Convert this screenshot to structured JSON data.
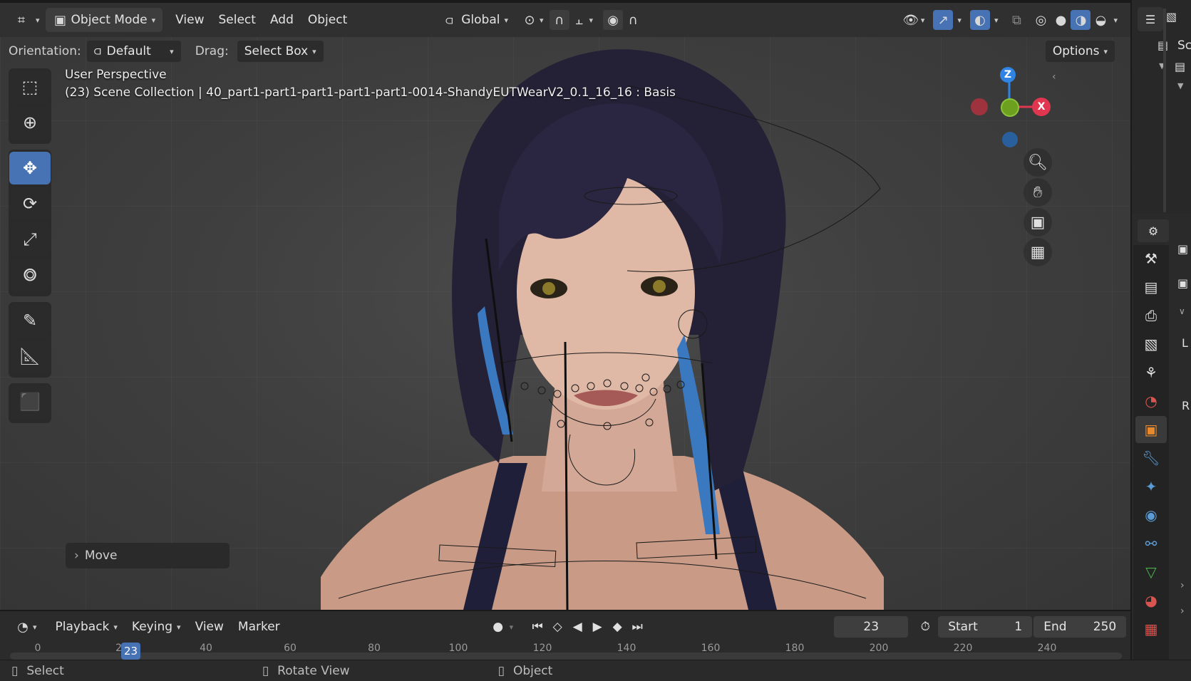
{
  "header": {
    "editor_type_icon": "grid-editor-icon",
    "mode": "Object Mode",
    "menus": [
      "View",
      "Select",
      "Add",
      "Object"
    ],
    "transform_orientation": "Global"
  },
  "tool_settings": {
    "orientation_label": "Orientation:",
    "orientation_value": "Default",
    "drag_label": "Drag:",
    "drag_value": "Select Box",
    "options": "Options"
  },
  "viewport": {
    "perspective": "User Perspective",
    "scene_info": "(23) Scene Collection | 40_part1-part1-part1-part1-part1-0014-ShandyEUTWearV2_0.1_16_16 : Basis",
    "gizmo": {
      "z": "Z",
      "x": "X"
    }
  },
  "last_operator": "Move",
  "timeline": {
    "menus": [
      "Playback",
      "Keying",
      "View",
      "Marker"
    ],
    "current_frame": "23",
    "start_label": "Start",
    "start_value": "1",
    "end_label": "End",
    "end_value": "250",
    "ruler_ticks": [
      "0",
      "20",
      "40",
      "60",
      "80",
      "100",
      "120",
      "140",
      "160",
      "180",
      "200",
      "220",
      "240"
    ],
    "frame_marker": "23"
  },
  "status_bar": {
    "left": "Select",
    "middle": "Rotate View",
    "right": "Object"
  },
  "sidebar": {
    "outliner_text": "Sc",
    "props_text_1": "L",
    "props_text_2": "R"
  },
  "colors": {
    "accent": "#4772b3",
    "x_axis": "#e0364f",
    "y_axis": "#6ea020",
    "z_axis": "#2f84e3"
  }
}
